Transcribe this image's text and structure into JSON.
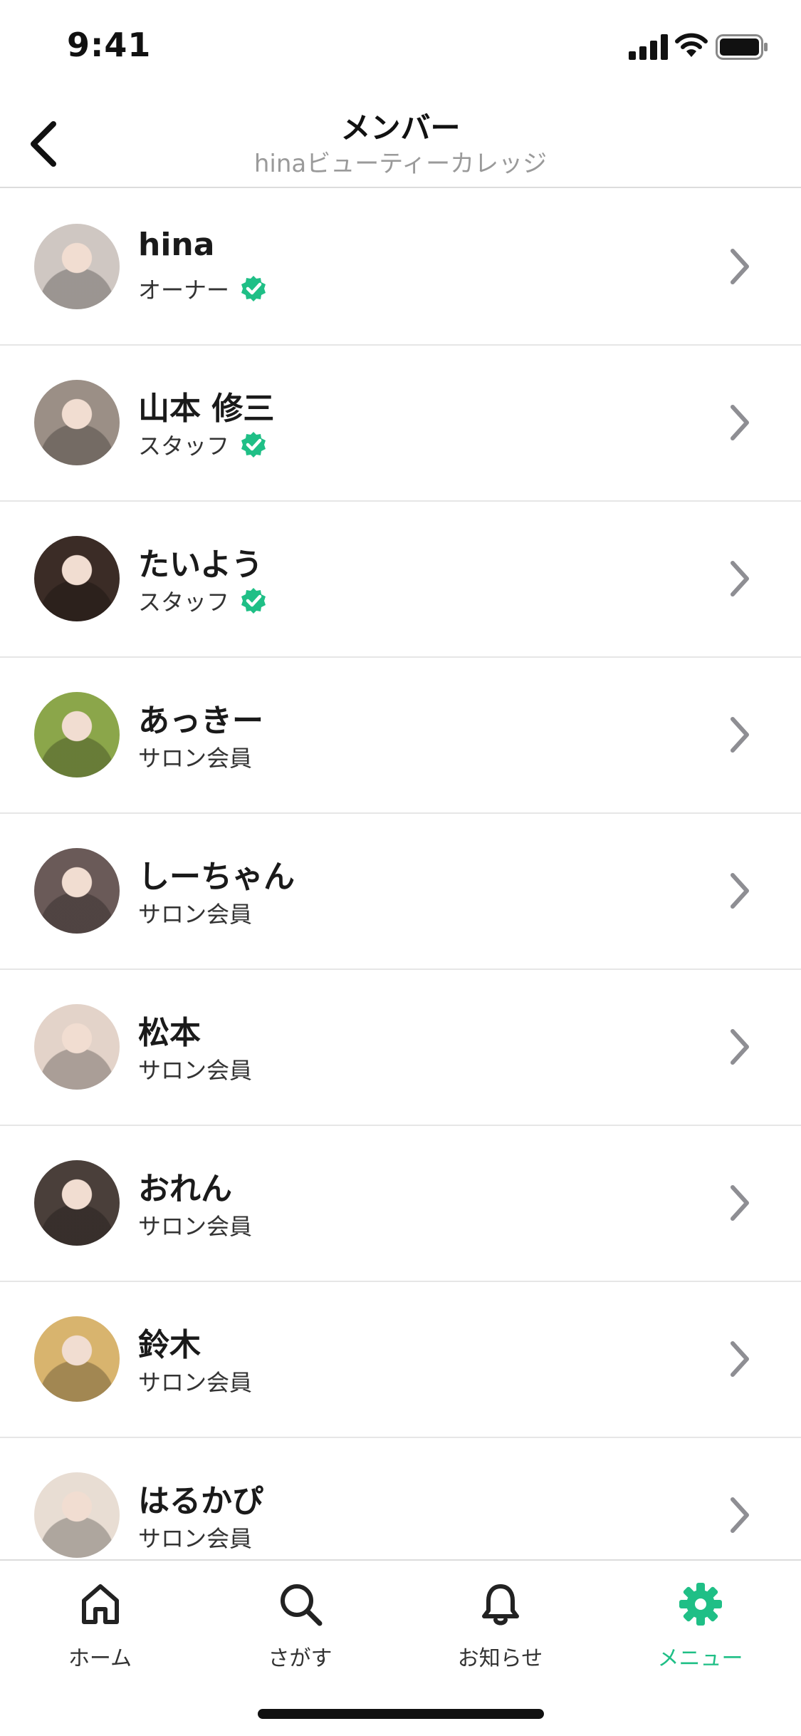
{
  "status_bar": {
    "time": "9:41"
  },
  "header": {
    "title": "メンバー",
    "subtitle": "hinaビューティーカレッジ"
  },
  "members": [
    {
      "name": "hina",
      "role": "オーナー",
      "verified": true,
      "avatar_bg": "#cfc7c2"
    },
    {
      "name": "山本 修三",
      "role": "スタッフ",
      "verified": true,
      "avatar_bg": "#9b8f86"
    },
    {
      "name": "たいよう",
      "role": "スタッフ",
      "verified": true,
      "avatar_bg": "#3b2c26"
    },
    {
      "name": "あっきー",
      "role": "サロン会員",
      "verified": false,
      "avatar_bg": "#8ba64a"
    },
    {
      "name": "しーちゃん",
      "role": "サロン会員",
      "verified": false,
      "avatar_bg": "#6a5a58"
    },
    {
      "name": "松本",
      "role": "サロン会員",
      "verified": false,
      "avatar_bg": "#e3d3c9"
    },
    {
      "name": "おれん",
      "role": "サロン会員",
      "verified": false,
      "avatar_bg": "#4a3f3a"
    },
    {
      "name": "鈴木",
      "role": "サロン会員",
      "verified": false,
      "avatar_bg": "#d8b46e"
    },
    {
      "name": "はるかぴ",
      "role": "サロン会員",
      "verified": false,
      "avatar_bg": "#e8ddd3"
    }
  ],
  "tabs": [
    {
      "label": "ホーム",
      "icon": "home-icon",
      "active": false
    },
    {
      "label": "さがす",
      "icon": "search-icon",
      "active": false
    },
    {
      "label": "お知らせ",
      "icon": "bell-icon",
      "active": false
    },
    {
      "label": "メニュー",
      "icon": "gear-icon",
      "active": true
    }
  ],
  "colors": {
    "accent": "#1fbf86",
    "verified": "#1fbf86",
    "chevron": "#8e8e93"
  }
}
